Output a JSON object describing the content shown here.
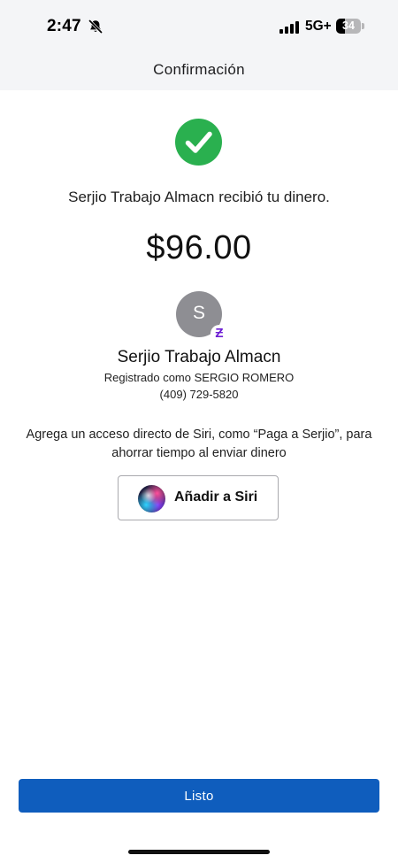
{
  "status_bar": {
    "time": "2:47",
    "network": "5G+",
    "battery_level": "34",
    "icons": [
      "bell-slash-icon",
      "signal-bars-icon",
      "battery-icon"
    ]
  },
  "header": {
    "title": "Confirmación"
  },
  "confirmation": {
    "icon": "checkmark-circle-icon",
    "message": "Serjio Trabajo Almacn recibió tu dinero.",
    "amount": "$96.00"
  },
  "recipient": {
    "initial": "S",
    "badge_icon": "zelle-icon",
    "badge_glyph": "Ƶ",
    "name": "Serjio Trabajo Almacn",
    "registered_as": "Registrado como SERGIO ROMERO",
    "phone": "(409) 729-5820"
  },
  "siri": {
    "hint": "Agrega un acceso directo de Siri, como “Paga a Serjio”, para ahorrar tiempo al enviar dinero",
    "button_label": "Añadir a Siri",
    "icon": "siri-icon"
  },
  "footer": {
    "done_label": "Listo"
  },
  "colors": {
    "header_bg": "#f4f5f7",
    "success_green": "#2ab04f",
    "primary_blue": "#0f5dbd",
    "avatar_gray": "#8e8e93",
    "zelle_purple": "#6d1ed4"
  }
}
